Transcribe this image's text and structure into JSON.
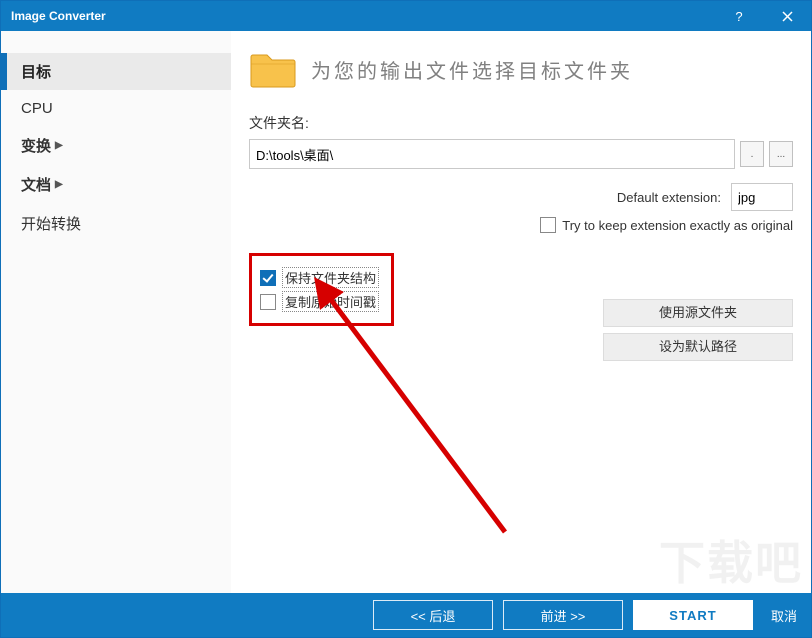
{
  "window": {
    "title": "Image Converter"
  },
  "sidebar": {
    "items": [
      {
        "label": "目标",
        "selected": true,
        "expandable": false,
        "bold": true
      },
      {
        "label": "CPU",
        "selected": false,
        "expandable": false,
        "bold": false
      },
      {
        "label": "变换",
        "selected": false,
        "expandable": true,
        "bold": true
      },
      {
        "label": "文档",
        "selected": false,
        "expandable": true,
        "bold": true
      },
      {
        "label": "开始转换",
        "selected": false,
        "expandable": false,
        "bold": false
      }
    ]
  },
  "main": {
    "header": "为您的输出文件选择目标文件夹",
    "folder_name_label": "文件夹名:",
    "path_value": "D:\\tools\\桌面\\",
    "dot_button": ".",
    "browse_button": "...",
    "default_ext_label": "Default extension:",
    "default_ext_value": "jpg",
    "keep_ext": {
      "checked": false,
      "label": "Try to keep extension exactly as original"
    },
    "opts": {
      "keep_structure": {
        "checked": true,
        "label": "保持文件夹结构"
      },
      "copy_timestamp": {
        "checked": false,
        "label": "复制原始时间戳"
      }
    },
    "buttons": {
      "use_source": "使用源文件夹",
      "set_default": "设为默认路径"
    }
  },
  "bottom": {
    "back": "<< 后退",
    "forward": "前进 >>",
    "start": "START",
    "cancel": "取消"
  },
  "watermark": "下载吧"
}
